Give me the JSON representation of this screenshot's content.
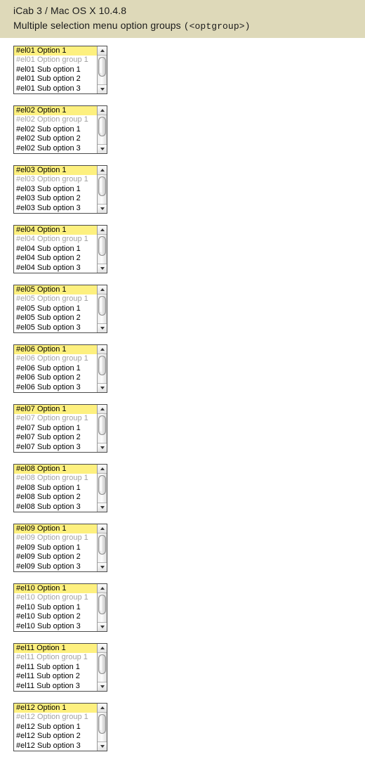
{
  "header": {
    "line1": "iCab 3 / Mac OS X 10.4.8",
    "line2_text": "Multiple selection menu option groups ",
    "line2_code": "(<optgroup>)"
  },
  "colors": {
    "header_background": "#ded9b9",
    "page_background": "#ffffff",
    "selected_option": "#fdf07f",
    "option_group_text": "#a0a0a0",
    "option_text": "#000000",
    "box_border": "#4c4c4c"
  },
  "selects": [
    {
      "id": "el01",
      "options": [
        {
          "label": "#el01 Option 1",
          "type": "option",
          "selected": true
        },
        {
          "label": "#el01 Option group 1",
          "type": "group",
          "selected": false
        },
        {
          "label": "#el01 Sub option 1",
          "type": "option",
          "selected": false
        },
        {
          "label": "#el01 Sub option 2",
          "type": "option",
          "selected": false
        },
        {
          "label": "#el01 Sub option 3",
          "type": "option",
          "selected": false
        }
      ]
    },
    {
      "id": "el02",
      "options": [
        {
          "label": "#el02 Option 1",
          "type": "option",
          "selected": true
        },
        {
          "label": "#el02 Option group 1",
          "type": "group",
          "selected": false
        },
        {
          "label": "#el02 Sub option 1",
          "type": "option",
          "selected": false
        },
        {
          "label": "#el02 Sub option 2",
          "type": "option",
          "selected": false
        },
        {
          "label": "#el02 Sub option 3",
          "type": "option",
          "selected": false
        }
      ]
    },
    {
      "id": "el03",
      "options": [
        {
          "label": "#el03 Option 1",
          "type": "option",
          "selected": true
        },
        {
          "label": "#el03 Option group 1",
          "type": "group",
          "selected": false
        },
        {
          "label": "#el03 Sub option 1",
          "type": "option",
          "selected": false
        },
        {
          "label": "#el03 Sub option 2",
          "type": "option",
          "selected": false
        },
        {
          "label": "#el03 Sub option 3",
          "type": "option",
          "selected": false
        }
      ]
    },
    {
      "id": "el04",
      "options": [
        {
          "label": "#el04 Option 1",
          "type": "option",
          "selected": true
        },
        {
          "label": "#el04 Option group 1",
          "type": "group",
          "selected": false
        },
        {
          "label": "#el04 Sub option 1",
          "type": "option",
          "selected": false
        },
        {
          "label": "#el04 Sub option 2",
          "type": "option",
          "selected": false
        },
        {
          "label": "#el04 Sub option 3",
          "type": "option",
          "selected": false
        }
      ]
    },
    {
      "id": "el05",
      "options": [
        {
          "label": "#el05 Option 1",
          "type": "option",
          "selected": true
        },
        {
          "label": "#el05 Option group 1",
          "type": "group",
          "selected": false
        },
        {
          "label": "#el05 Sub option 1",
          "type": "option",
          "selected": false
        },
        {
          "label": "#el05 Sub option 2",
          "type": "option",
          "selected": false
        },
        {
          "label": "#el05 Sub option 3",
          "type": "option",
          "selected": false
        }
      ]
    },
    {
      "id": "el06",
      "options": [
        {
          "label": "#el06 Option 1",
          "type": "option",
          "selected": true
        },
        {
          "label": "#el06 Option group 1",
          "type": "group",
          "selected": false
        },
        {
          "label": "#el06 Sub option 1",
          "type": "option",
          "selected": false
        },
        {
          "label": "#el06 Sub option 2",
          "type": "option",
          "selected": false
        },
        {
          "label": "#el06 Sub option 3",
          "type": "option",
          "selected": false
        }
      ]
    },
    {
      "id": "el07",
      "options": [
        {
          "label": "#el07 Option 1",
          "type": "option",
          "selected": true
        },
        {
          "label": "#el07 Option group 1",
          "type": "group",
          "selected": false
        },
        {
          "label": "#el07 Sub option 1",
          "type": "option",
          "selected": false
        },
        {
          "label": "#el07 Sub option 2",
          "type": "option",
          "selected": false
        },
        {
          "label": "#el07 Sub option 3",
          "type": "option",
          "selected": false
        }
      ]
    },
    {
      "id": "el08",
      "options": [
        {
          "label": "#el08 Option 1",
          "type": "option",
          "selected": true
        },
        {
          "label": "#el08 Option group 1",
          "type": "group",
          "selected": false
        },
        {
          "label": "#el08 Sub option 1",
          "type": "option",
          "selected": false
        },
        {
          "label": "#el08 Sub option 2",
          "type": "option",
          "selected": false
        },
        {
          "label": "#el08 Sub option 3",
          "type": "option",
          "selected": false
        }
      ]
    },
    {
      "id": "el09",
      "options": [
        {
          "label": "#el09 Option 1",
          "type": "option",
          "selected": true
        },
        {
          "label": "#el09 Option group 1",
          "type": "group",
          "selected": false
        },
        {
          "label": "#el09 Sub option 1",
          "type": "option",
          "selected": false
        },
        {
          "label": "#el09 Sub option 2",
          "type": "option",
          "selected": false
        },
        {
          "label": "#el09 Sub option 3",
          "type": "option",
          "selected": false
        }
      ]
    },
    {
      "id": "el10",
      "options": [
        {
          "label": "#el10 Option 1",
          "type": "option",
          "selected": true
        },
        {
          "label": "#el10 Option group 1",
          "type": "group",
          "selected": false
        },
        {
          "label": "#el10 Sub option 1",
          "type": "option",
          "selected": false
        },
        {
          "label": "#el10 Sub option 2",
          "type": "option",
          "selected": false
        },
        {
          "label": "#el10 Sub option 3",
          "type": "option",
          "selected": false
        }
      ]
    },
    {
      "id": "el11",
      "options": [
        {
          "label": "#el11 Option 1",
          "type": "option",
          "selected": true
        },
        {
          "label": "#el11 Option group 1",
          "type": "group",
          "selected": false
        },
        {
          "label": "#el11 Sub option 1",
          "type": "option",
          "selected": false
        },
        {
          "label": "#el11 Sub option 2",
          "type": "option",
          "selected": false
        },
        {
          "label": "#el11 Sub option 3",
          "type": "option",
          "selected": false
        }
      ]
    },
    {
      "id": "el12",
      "options": [
        {
          "label": "#el12 Option 1",
          "type": "option",
          "selected": true
        },
        {
          "label": "#el12 Option group 1",
          "type": "group",
          "selected": false
        },
        {
          "label": "#el12 Sub option 1",
          "type": "option",
          "selected": false
        },
        {
          "label": "#el12 Sub option 2",
          "type": "option",
          "selected": false
        },
        {
          "label": "#el12 Sub option 3",
          "type": "option",
          "selected": false
        }
      ]
    }
  ]
}
